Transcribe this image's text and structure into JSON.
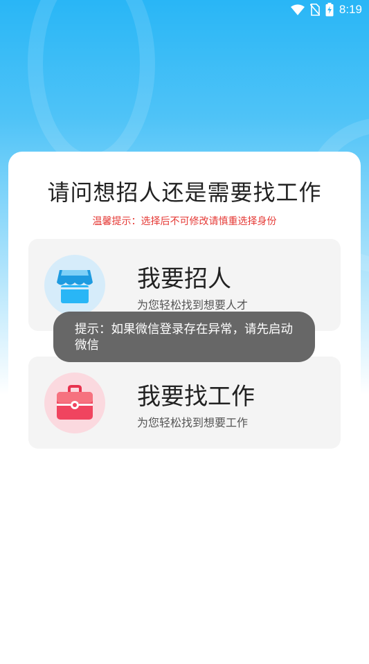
{
  "status_bar": {
    "time": "8:19",
    "icons": [
      "wifi-icon",
      "no-sim-icon",
      "battery-charging-icon"
    ]
  },
  "card": {
    "title": "请问想招人还是需要找工作",
    "warning": "温馨提示：选择后不可修改请慎重选择身份",
    "warning_color": "#e53935"
  },
  "options": [
    {
      "title": "我要招人",
      "subtitle": "为您轻松找到想要人才",
      "icon": "storefront-icon",
      "accent": "#29b6f6"
    },
    {
      "title": "我要找工作",
      "subtitle": "为您轻松找到想要工作",
      "icon": "briefcase-icon",
      "accent": "#f0445f"
    }
  ],
  "toast": {
    "text": "提示：如果微信登录存在异常，请先启动微信"
  },
  "colors": {
    "header_blue": "#29b6f6",
    "option_bg": "#f4f4f4"
  }
}
